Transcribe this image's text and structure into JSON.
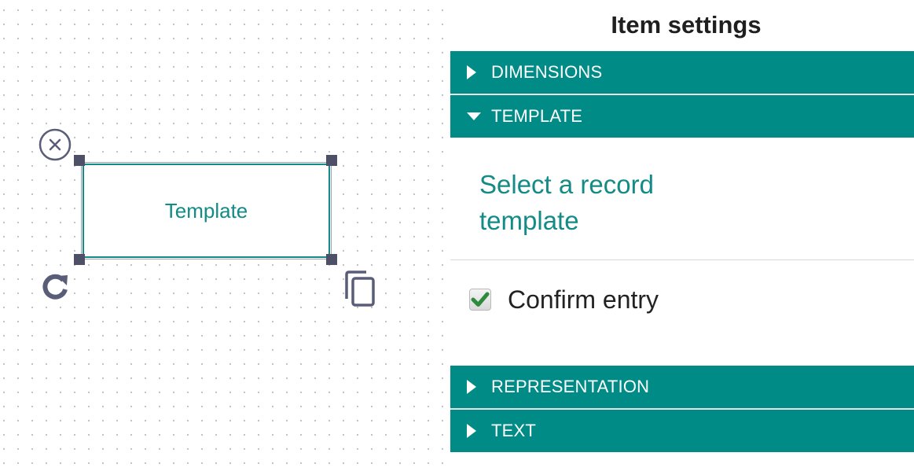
{
  "canvas": {
    "item": {
      "label": "Template"
    },
    "tools": {
      "delete_icon": "close-circle-icon",
      "rotate_icon": "rotate-icon",
      "copy_icon": "copy-icon"
    }
  },
  "panel": {
    "title": "Item settings",
    "sections": [
      {
        "label": "DIMENSIONS",
        "expanded": false
      },
      {
        "label": "TEMPLATE",
        "expanded": true
      },
      {
        "label": "REPRESENTATION",
        "expanded": false
      },
      {
        "label": "TEXT",
        "expanded": false
      }
    ],
    "template": {
      "select_link": "Select a record template",
      "confirm_entry": {
        "label": "Confirm entry",
        "checked": true
      }
    }
  },
  "colors": {
    "accent": "#008b86",
    "link": "#138b86",
    "handle": "#4d5066",
    "icon": "#5a5d78",
    "check": "#2e8b3e"
  }
}
